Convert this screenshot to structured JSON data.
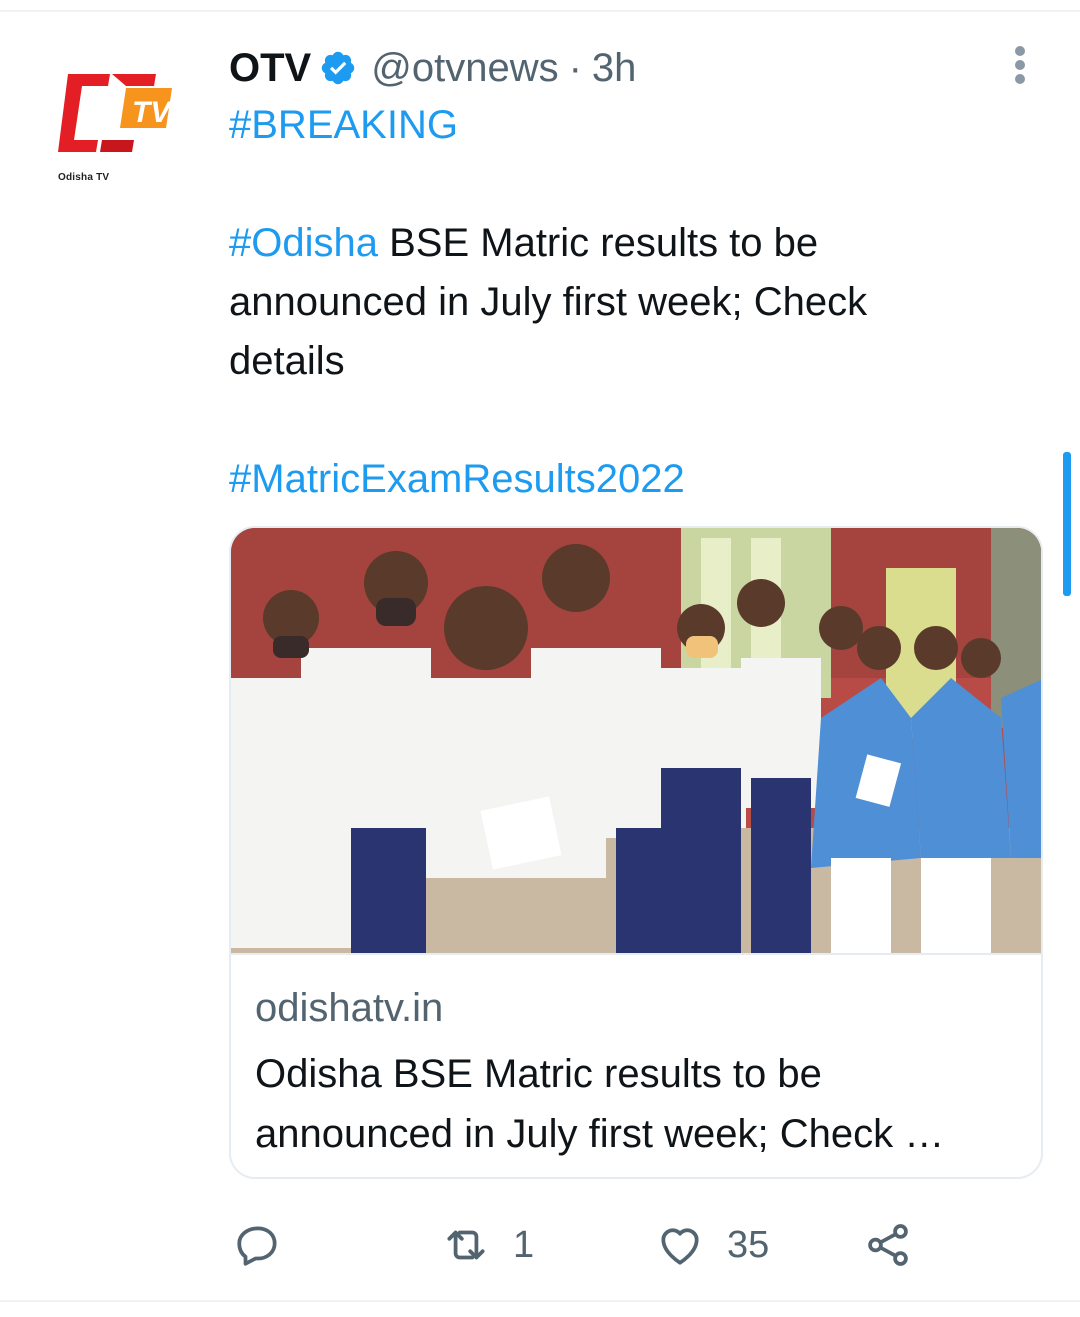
{
  "author": {
    "name": "OTV",
    "handle": "@otvnews",
    "separator": "·",
    "time": "3h",
    "verified": true,
    "avatar_caption": "Odisha TV"
  },
  "tweet": {
    "breaking": "#BREAKING",
    "line_hashtag": "#Odisha",
    "line_text": " BSE Matric results to be announced in July first week; Check details",
    "hashtag2": "#MatricExamResults2022"
  },
  "card": {
    "domain": "odishatv.in",
    "title": "Odisha BSE Matric results to be announced in July first week; Check …",
    "image_alt": "students-walking-photo"
  },
  "actions": {
    "reply_count": "",
    "retweet_count": "1",
    "like_count": "35"
  },
  "icons": {
    "verified": "verified-badge-icon",
    "more": "more-vertical-icon",
    "reply": "reply-icon",
    "retweet": "retweet-icon",
    "like": "heart-icon",
    "share": "share-icon"
  },
  "colors": {
    "accent": "#1d9bf0",
    "text": "#0f1419",
    "muted": "#536471",
    "logo_red": "#e31e24",
    "logo_orange": "#f7941d"
  }
}
